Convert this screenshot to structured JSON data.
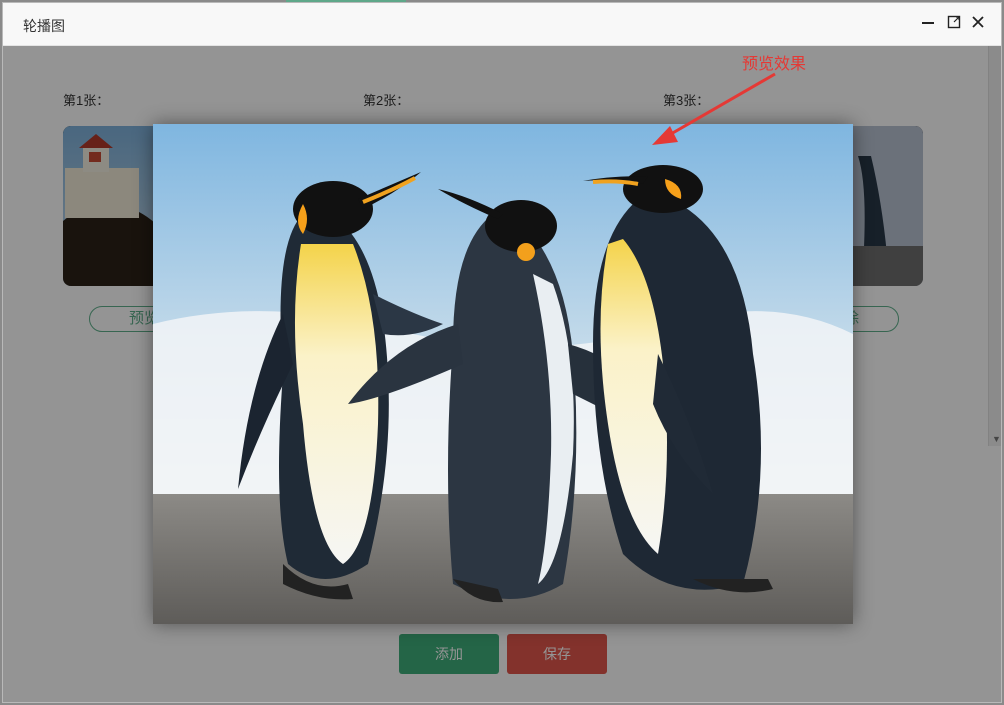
{
  "window": {
    "title": "轮播图"
  },
  "slots": [
    {
      "label": "第1张："
    },
    {
      "label": "第2张："
    },
    {
      "label": "第3张："
    }
  ],
  "buttons": {
    "preview": "预览",
    "delete": "删除",
    "add": "添加",
    "save": "保存"
  },
  "annotation": {
    "text": "预览效果"
  },
  "colors": {
    "accent_green": "#3fae7a",
    "danger_red": "#e2574c",
    "annotation_red": "#e53935"
  },
  "icons": [
    "minimize-icon",
    "maximize-icon",
    "close-icon",
    "scroll-down-icon"
  ]
}
